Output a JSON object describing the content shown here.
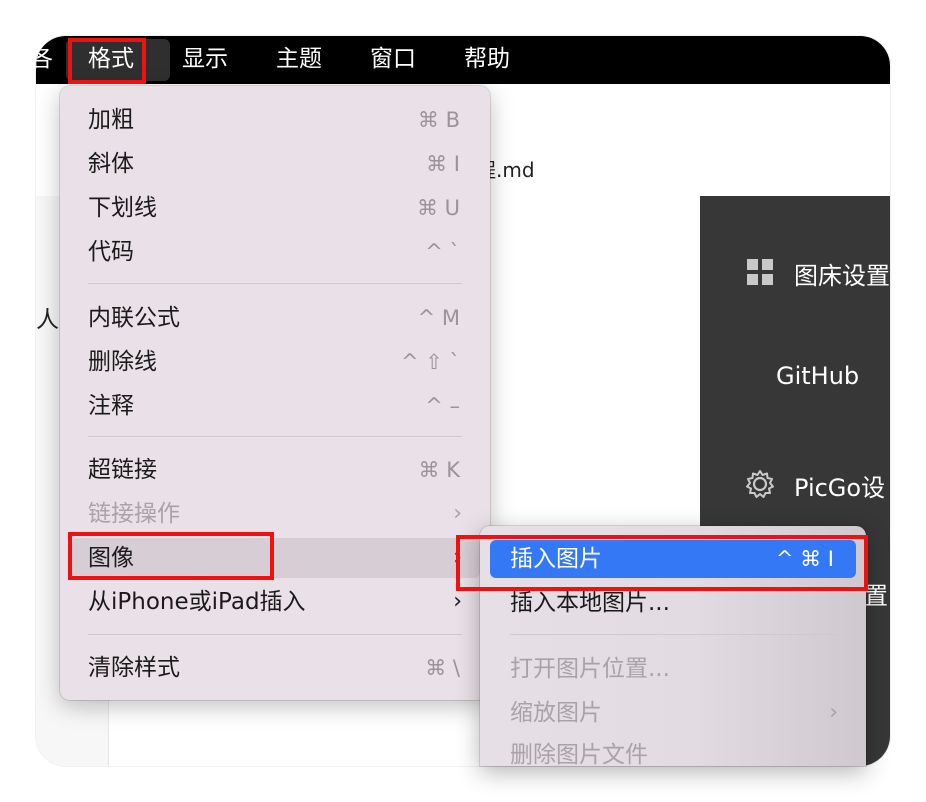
{
  "menubar": {
    "partial_left": "各",
    "items": [
      "格式",
      "显示",
      "主题",
      "窗口",
      "帮助"
    ],
    "active": "格式"
  },
  "window": {
    "filename_partial": "程.md",
    "left_text_partial": "人图"
  },
  "sidepanel": {
    "items": [
      {
        "label": "图床设置",
        "icon": "grid-icon"
      },
      {
        "label": "GitHub",
        "icon": ""
      },
      {
        "label": "PicGo设",
        "icon": "gear-icon"
      },
      {
        "label": "设置",
        "icon": ""
      }
    ]
  },
  "format_menu": {
    "items": [
      {
        "label": "加粗",
        "shortcut": "⌘ B"
      },
      {
        "label": "斜体",
        "shortcut": "⌘ I"
      },
      {
        "label": "下划线",
        "shortcut": "⌘ U"
      },
      {
        "label": "代码",
        "shortcut": "^ `"
      },
      {
        "label": "内联公式",
        "shortcut": "^ M"
      },
      {
        "label": "删除线",
        "shortcut": "^ ⇧ `"
      },
      {
        "label": "注释",
        "shortcut": "^ –"
      },
      {
        "label": "超链接",
        "shortcut": "⌘ K"
      },
      {
        "label": "链接操作",
        "shortcut": "",
        "disabled": true,
        "submenu": true
      },
      {
        "label": "图像",
        "shortcut": "",
        "submenu": true,
        "highlighted": true
      },
      {
        "label": "从iPhone或iPad插入",
        "shortcut": "",
        "submenu": true
      },
      {
        "label": "清除样式",
        "shortcut": "⌘ \\"
      }
    ]
  },
  "image_submenu": {
    "items": [
      {
        "label": "插入图片",
        "shortcut": "^ ⌘ I",
        "selected": true
      },
      {
        "label": "插入本地图片...",
        "shortcut": ""
      },
      {
        "label": "打开图片位置...",
        "shortcut": "",
        "disabled": true
      },
      {
        "label": "缩放图片",
        "shortcut": "",
        "disabled": true,
        "submenu": true
      },
      {
        "label": "删除图片文件",
        "shortcut": "",
        "disabled": true
      }
    ]
  },
  "chevron": "›",
  "colors": {
    "menubar": "#000000",
    "menu_bg": "#e9e1e7",
    "selection": "#3478f6",
    "annotation": "#ee1111",
    "sidepanel": "#373737"
  }
}
